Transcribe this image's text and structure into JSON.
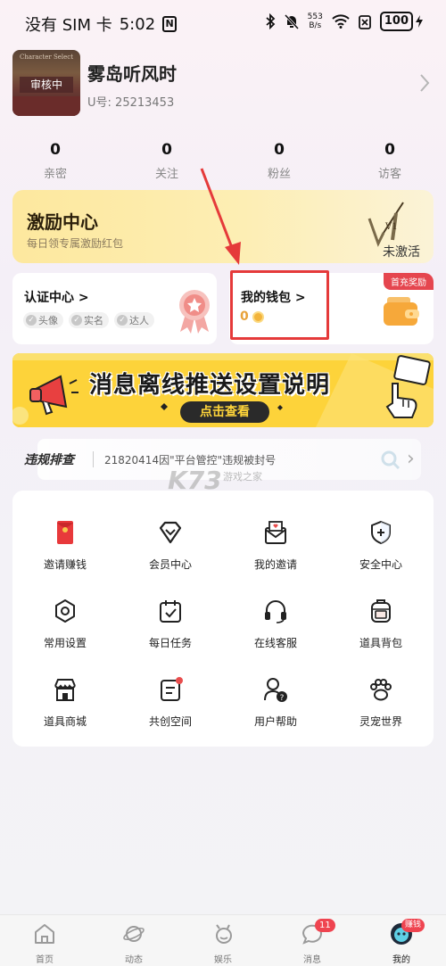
{
  "status_bar": {
    "carrier": "没有 SIM 卡",
    "time": "5:02",
    "nfc": "N",
    "net_speed_value": "553",
    "net_speed_unit": "B/s",
    "battery": "100"
  },
  "profile": {
    "avatar_top_text": "Character Select",
    "avatar_status": "审核中",
    "username": "雾岛听风时",
    "uid_label": "U号:",
    "uid_value": "25213453"
  },
  "stats": [
    {
      "value": "0",
      "label": "亲密"
    },
    {
      "value": "0",
      "label": "关注"
    },
    {
      "value": "0",
      "label": "粉丝"
    },
    {
      "value": "0",
      "label": "访客"
    }
  ],
  "incentive": {
    "title": "激励中心",
    "subtitle": "每日领专属激励红包",
    "badge": "V1",
    "status": "未激活"
  },
  "certification": {
    "title": "认证中心 >",
    "tags": [
      "头像",
      "实名",
      "达人"
    ]
  },
  "wallet": {
    "title": "我的钱包 >",
    "amount": "0",
    "ribbon": "首充奖励"
  },
  "promo": {
    "title": "消息离线推送设置说明",
    "button": "点击查看"
  },
  "violation": {
    "title": "违规排查",
    "text": "21820414因\"平台管控\"违规被封号"
  },
  "watermark": {
    "main": "K73",
    "sub": "游戏之家"
  },
  "grid": [
    {
      "label": "邀请赚钱",
      "icon": "red-envelope-icon"
    },
    {
      "label": "会员中心",
      "icon": "diamond-icon"
    },
    {
      "label": "我的邀请",
      "icon": "invitation-mail-icon"
    },
    {
      "label": "安全中心",
      "icon": "shield-icon"
    },
    {
      "label": "常用设置",
      "icon": "settings-icon"
    },
    {
      "label": "每日任务",
      "icon": "calendar-check-icon"
    },
    {
      "label": "在线客服",
      "icon": "headset-icon"
    },
    {
      "label": "道具背包",
      "icon": "backpack-icon"
    },
    {
      "label": "道具商城",
      "icon": "store-icon"
    },
    {
      "label": "共创空间",
      "icon": "notes-icon"
    },
    {
      "label": "用户帮助",
      "icon": "user-help-icon"
    },
    {
      "label": "灵宠世界",
      "icon": "paw-icon"
    }
  ],
  "nav": [
    {
      "label": "首页",
      "icon": "home-icon"
    },
    {
      "label": "动态",
      "icon": "planet-icon"
    },
    {
      "label": "娱乐",
      "icon": "entertainment-icon"
    },
    {
      "label": "消息",
      "icon": "message-icon",
      "badge": "11"
    },
    {
      "label": "我的",
      "icon": "profile-face-icon",
      "badge": "赚钱"
    }
  ],
  "colors": {
    "accent_red": "#e53a3a",
    "incentive_bg": "#fde89e",
    "promo_bg": "#fdd33a",
    "badge_red": "#ef4450",
    "coin": "#f2b43c"
  }
}
